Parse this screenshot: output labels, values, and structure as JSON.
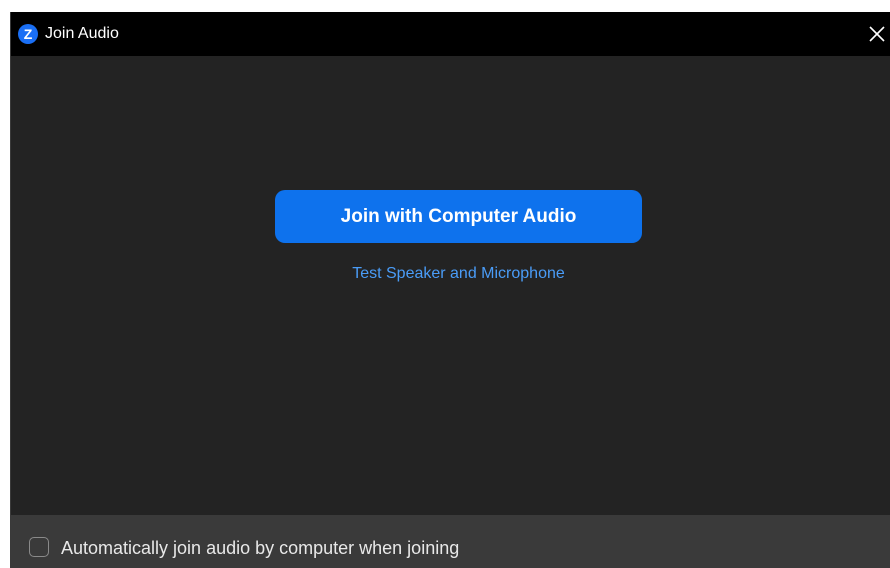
{
  "window": {
    "title": "Join Audio",
    "logo_icon": "zoom-logo-icon",
    "logo_letter": "Z",
    "close_icon": "close-icon"
  },
  "main": {
    "join_button_label": "Join with Computer Audio",
    "test_link_label": "Test Speaker and Microphone"
  },
  "footer": {
    "auto_join_checkbox_checked": false,
    "auto_join_label": "Automatically join audio by computer when joining"
  },
  "colors": {
    "accent": "#0e72ed",
    "link": "#4a9cf7",
    "background": "#232323",
    "titlebar": "#000000",
    "footer": "#3a3a3a"
  }
}
